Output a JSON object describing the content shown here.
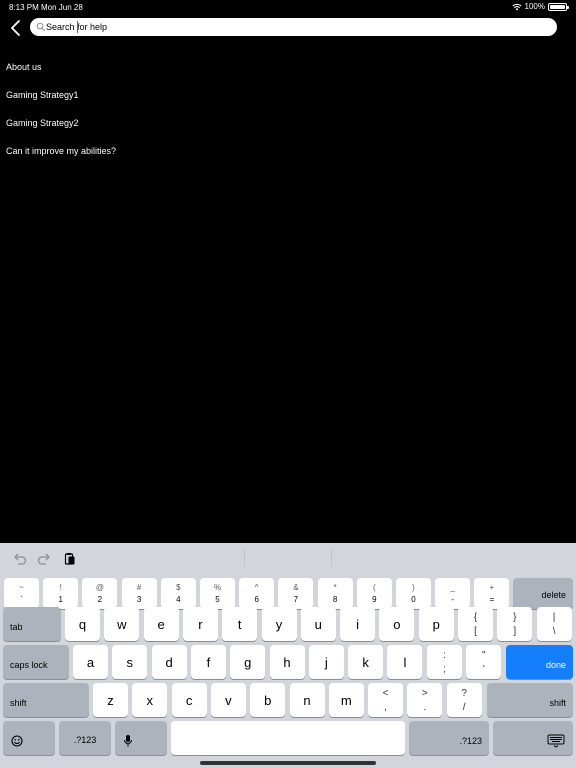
{
  "status_bar": {
    "time": "8:13 PM",
    "date": "Mon Jun 28",
    "battery": "100%"
  },
  "search": {
    "placeholder": "Search for help",
    "value": ""
  },
  "help_items": [
    "About us",
    "Gaming Strategy1",
    "Gaming Strategy2",
    "Can it improve my abilities?"
  ],
  "keyboard": {
    "number_row": [
      {
        "top": "~",
        "bottom": "`"
      },
      {
        "top": "!",
        "bottom": "1"
      },
      {
        "top": "@",
        "bottom": "2"
      },
      {
        "top": "#",
        "bottom": "3"
      },
      {
        "top": "$",
        "bottom": "4"
      },
      {
        "top": "%",
        "bottom": "5"
      },
      {
        "top": "^",
        "bottom": "6"
      },
      {
        "top": "&",
        "bottom": "7"
      },
      {
        "top": "*",
        "bottom": "8"
      },
      {
        "top": "(",
        "bottom": "9"
      },
      {
        "top": ")",
        "bottom": "0"
      },
      {
        "top": "_",
        "bottom": "-"
      },
      {
        "top": "+",
        "bottom": "="
      }
    ],
    "delete_label": "delete",
    "tab_label": "tab",
    "row_q": [
      "q",
      "w",
      "e",
      "r",
      "t",
      "y",
      "u",
      "i",
      "o",
      "p"
    ],
    "row_q_pairs": [
      {
        "top": "{",
        "bottom": "["
      },
      {
        "top": "}",
        "bottom": "]"
      },
      {
        "top": "|",
        "bottom": "\\"
      }
    ],
    "caps_label": "caps lock",
    "row_a": [
      "a",
      "s",
      "d",
      "f",
      "g",
      "h",
      "j",
      "k",
      "l"
    ],
    "row_a_pairs": [
      {
        "top": ":",
        "bottom": ";"
      },
      {
        "top": "\"",
        "bottom": "'"
      }
    ],
    "done_label": "done",
    "shift_label": "shift",
    "row_z": [
      "z",
      "x",
      "c",
      "v",
      "b",
      "n",
      "m"
    ],
    "row_z_pairs": [
      {
        "top": "<",
        "bottom": ","
      },
      {
        "top": ">",
        "bottom": "."
      },
      {
        "top": "?",
        "bottom": "/"
      }
    ],
    "numbers_label": ".?123"
  }
}
